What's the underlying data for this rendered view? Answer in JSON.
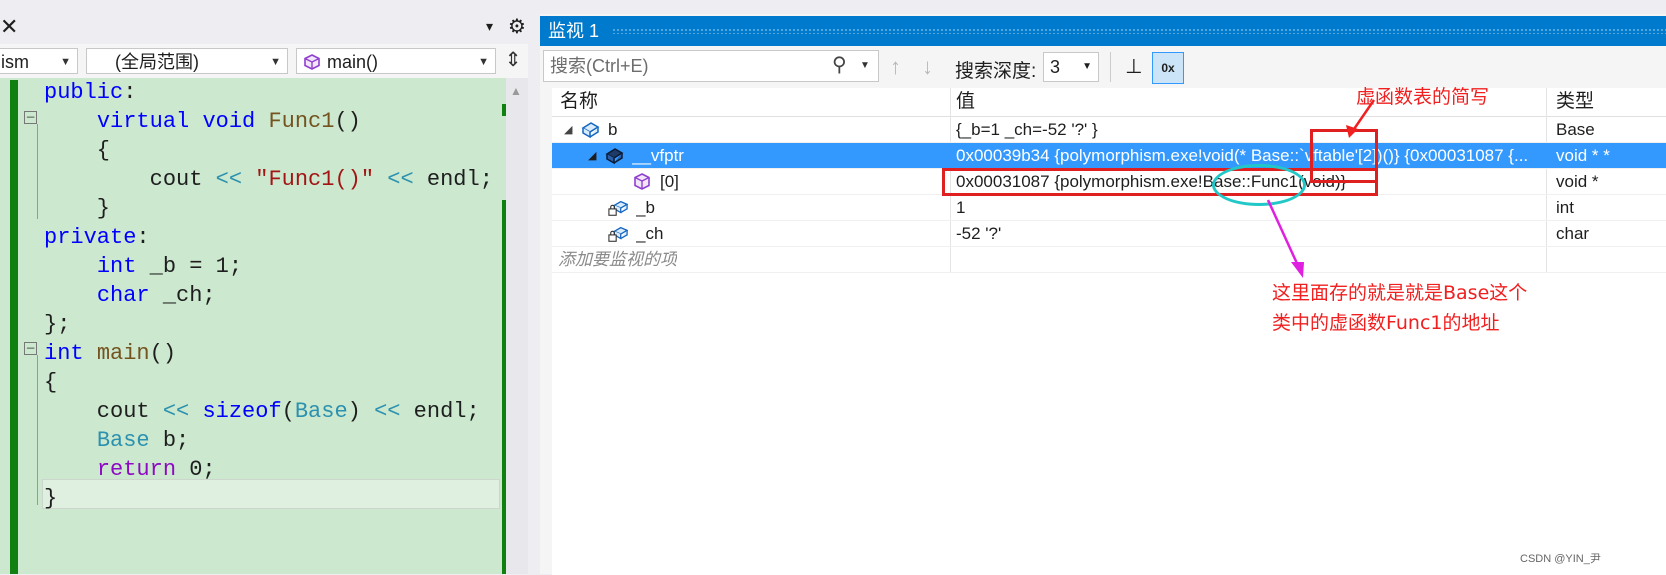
{
  "editor": {
    "close_glyph": "✕",
    "project_combo": "ism",
    "scope_combo": "(全局范围)",
    "member_combo": "main()",
    "code_lines": [
      [
        {
          "t": "public",
          "c": "kw"
        },
        {
          "t": ":",
          "c": "pl"
        }
      ],
      [
        {
          "t": "    ",
          "c": "pl"
        },
        {
          "t": "virtual",
          "c": "kw"
        },
        {
          "t": " ",
          "c": "pl"
        },
        {
          "t": "void",
          "c": "kw"
        },
        {
          "t": " ",
          "c": "pl"
        },
        {
          "t": "Func1",
          "c": "fn"
        },
        {
          "t": "()",
          "c": "pl"
        }
      ],
      [
        {
          "t": "    {",
          "c": "pl"
        }
      ],
      [
        {
          "t": "        cout ",
          "c": "pl"
        },
        {
          "t": "<<",
          "c": "ty"
        },
        {
          "t": " ",
          "c": "pl"
        },
        {
          "t": "\"Func1()\"",
          "c": "st"
        },
        {
          "t": " ",
          "c": "pl"
        },
        {
          "t": "<<",
          "c": "ty"
        },
        {
          "t": " endl;",
          "c": "pl"
        }
      ],
      [
        {
          "t": "    }",
          "c": "pl"
        }
      ],
      [
        {
          "t": "private",
          "c": "kw"
        },
        {
          "t": ":",
          "c": "pl"
        }
      ],
      [
        {
          "t": "    ",
          "c": "pl"
        },
        {
          "t": "int",
          "c": "kw"
        },
        {
          "t": " _b = 1;",
          "c": "pl"
        }
      ],
      [
        {
          "t": "    ",
          "c": "pl"
        },
        {
          "t": "char",
          "c": "kw"
        },
        {
          "t": " _ch;",
          "c": "pl"
        }
      ],
      [
        {
          "t": "};",
          "c": "pl"
        }
      ],
      [
        {
          "t": "int",
          "c": "kw"
        },
        {
          "t": " ",
          "c": "pl"
        },
        {
          "t": "main",
          "c": "fn"
        },
        {
          "t": "()",
          "c": "pl"
        }
      ],
      [
        {
          "t": "{",
          "c": "pl"
        }
      ],
      [
        {
          "t": "    cout ",
          "c": "pl"
        },
        {
          "t": "<<",
          "c": "ty"
        },
        {
          "t": " ",
          "c": "pl"
        },
        {
          "t": "sizeof",
          "c": "kw"
        },
        {
          "t": "(",
          "c": "pl"
        },
        {
          "t": "Base",
          "c": "ty"
        },
        {
          "t": ") ",
          "c": "pl"
        },
        {
          "t": "<<",
          "c": "ty"
        },
        {
          "t": " endl;",
          "c": "pl"
        }
      ],
      [
        {
          "t": "    ",
          "c": "pl"
        },
        {
          "t": "Base",
          "c": "ty"
        },
        {
          "t": " b;",
          "c": "pl"
        }
      ],
      [
        {
          "t": "    ",
          "c": "pl"
        },
        {
          "t": "return",
          "c": "ctrl"
        },
        {
          "t": " 0;",
          "c": "pl"
        }
      ],
      [
        {
          "t": "}",
          "c": "pl"
        }
      ]
    ]
  },
  "watch": {
    "title": "监视 1",
    "search_placeholder": "搜索(Ctrl+E)",
    "depth_label": "搜索深度:",
    "depth_value": "3",
    "hex_label": "0x",
    "columns": {
      "name": "名称",
      "value": "值",
      "type": "类型"
    },
    "rows": [
      {
        "name": "b",
        "value": "{_b=1 _ch=-52 '?' }",
        "type": "Base"
      },
      {
        "name": "__vfptr",
        "value": "0x00039b34 {polymorphism.exe!void(* Base::`vftable'[2])()} {0x00031087 {...",
        "type": "void * *"
      },
      {
        "name": "[0]",
        "value": "0x00031087 {polymorphism.exe!Base::Func1(void)}",
        "type": "void *"
      },
      {
        "name": "_b",
        "value": "1",
        "type": "int"
      },
      {
        "name": "_ch",
        "value": "-52 '?'",
        "type": "char"
      }
    ],
    "add_item": "添加要监视的项"
  },
  "annotations": {
    "label1": "虚函数表的简写",
    "label2": "这里面存的就是就是Base这个",
    "label3": "类中的虚函数Func1的地址"
  },
  "watermark": "CSDN @YIN_尹",
  "colors": {
    "accent": "#007acc",
    "selection": "#3399ff",
    "annotation_red": "#f02020",
    "annotation_cyan": "#22c8c8",
    "arrow_magenta": "#e020e0",
    "code_bg": "#cce8cf"
  }
}
